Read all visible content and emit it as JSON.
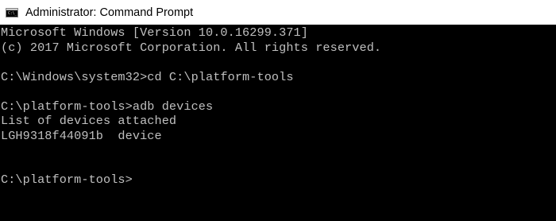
{
  "window": {
    "title": "Administrator: Command Prompt",
    "icon": "command-prompt-icon",
    "icon_caption": "C:\\_"
  },
  "console": {
    "lines": [
      "Microsoft Windows [Version 10.0.16299.371]",
      "(c) 2017 Microsoft Corporation. All rights reserved.",
      "",
      "C:\\Windows\\system32>cd C:\\platform-tools",
      "",
      "C:\\platform-tools>adb devices",
      "List of devices attached",
      "LGH9318f44091b  device",
      "",
      "",
      "C:\\platform-tools>"
    ]
  }
}
